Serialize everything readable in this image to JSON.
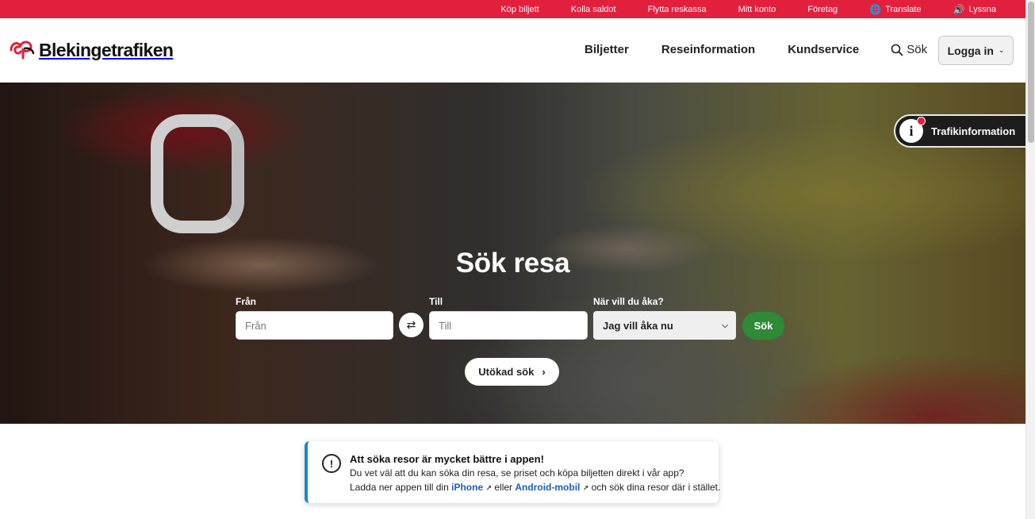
{
  "topbar": {
    "links": [
      "Köp biljett",
      "Kolla saldot",
      "Flytta reskassa",
      "Mitt konto",
      "Företag"
    ],
    "translate": "Translate",
    "listen": "Lyssna"
  },
  "header": {
    "logo_text": "Blekingetrafiken",
    "nav": [
      "Biljetter",
      "Reseinformation",
      "Kundservice"
    ],
    "search_label": "Sök",
    "login_label": "Logga in"
  },
  "traffic_info": {
    "label": "Trafikinformation"
  },
  "search": {
    "title": "Sök resa",
    "from_label": "Från",
    "from_placeholder": "Från",
    "to_label": "Till",
    "to_placeholder": "Till",
    "when_label": "När vill du åka?",
    "when_value": "Jag vill åka nu",
    "submit_label": "Sök",
    "advanced_label": "Utökad sök"
  },
  "notice": {
    "title": "Att söka resor är mycket bättre i appen!",
    "line1": "Du vet väl att du kan söka din resa, se priset och köpa biljetten direkt i vår app?",
    "line2_a": "Ladda ner appen till din",
    "iphone": "iPhone",
    "line2_b": "eller",
    "android": "Android-mobil",
    "line2_c": "och sök dina resor där i stället."
  }
}
